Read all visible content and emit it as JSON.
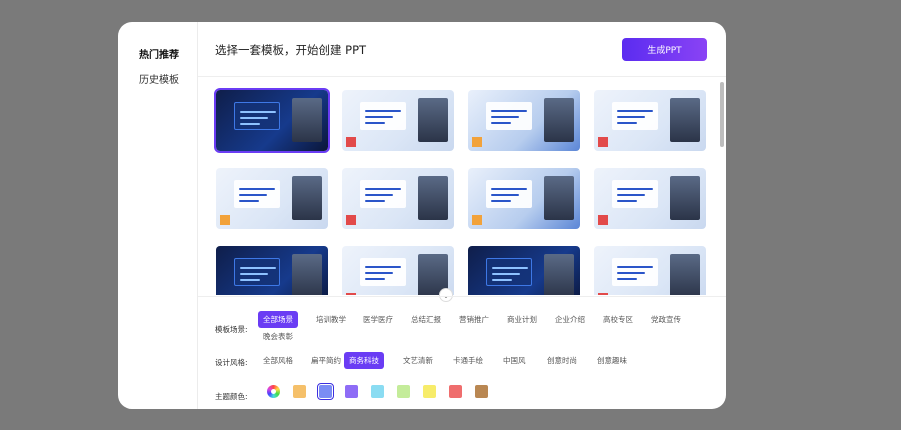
{
  "sidebar": {
    "items": [
      {
        "label": "热门推荐",
        "active": true
      },
      {
        "label": "历史模板",
        "active": false
      }
    ]
  },
  "header": {
    "title": "选择一套模板，开始创建 PPT",
    "generate_label": "生成PPT"
  },
  "templates": [
    {
      "style": "dark",
      "selected": true
    },
    {
      "style": "light",
      "selected": false
    },
    {
      "style": "blue",
      "selected": false
    },
    {
      "style": "light",
      "selected": false
    },
    {
      "style": "light",
      "selected": false
    },
    {
      "style": "light",
      "selected": false
    },
    {
      "style": "blue",
      "selected": false
    },
    {
      "style": "light",
      "selected": false
    },
    {
      "style": "dark",
      "selected": false
    },
    {
      "style": "light",
      "selected": false
    },
    {
      "style": "dark",
      "selected": false
    },
    {
      "style": "light",
      "selected": false
    }
  ],
  "filters": {
    "scene": {
      "label": "模板场景:",
      "options": [
        "全部场景",
        "培训教学",
        "医学医疗",
        "总结汇报",
        "营销推广",
        "商业计划",
        "企业介绍",
        "高校专区",
        "党政宣传",
        "晚会表彰"
      ],
      "selected": "全部场景"
    },
    "style": {
      "label": "设计风格:",
      "options": [
        "全部风格",
        "扁平简约",
        "商务科技",
        "文艺清新",
        "卡通手绘",
        "中国风",
        "创意时尚",
        "创意趣味"
      ],
      "selected": "商务科技"
    },
    "color": {
      "label": "主题颜色:",
      "swatches": [
        "#f5c06a",
        "#7b8df4",
        "#8e6cf6",
        "#8adcf2",
        "#c4ec9a",
        "#f7ec6a",
        "#ef6d6d",
        "#b98752"
      ],
      "selected_index": 1
    }
  }
}
